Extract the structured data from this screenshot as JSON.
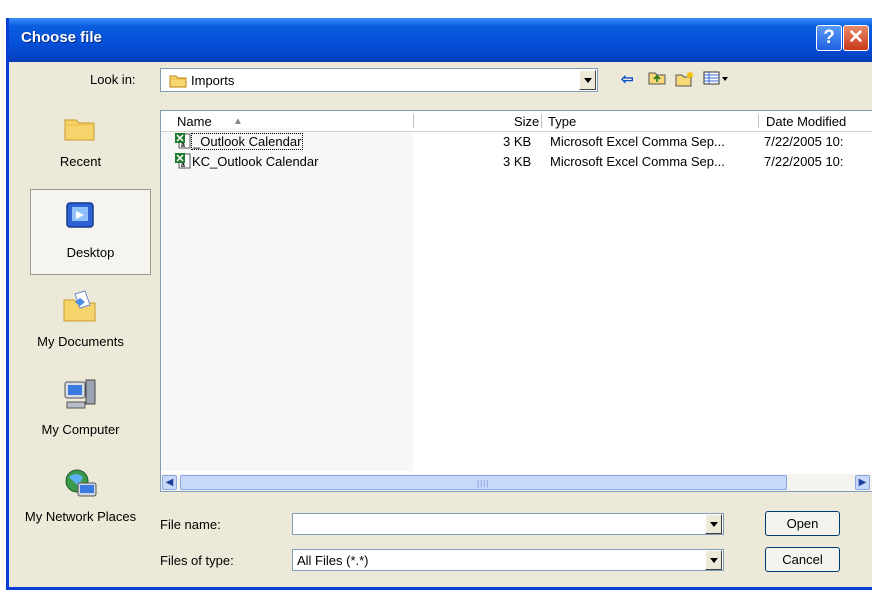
{
  "window": {
    "title": "Choose file"
  },
  "titlebar": {
    "help": "?",
    "close": "✕"
  },
  "lookin": {
    "label": "Look in:",
    "value": "Imports"
  },
  "toolbar": {
    "back": "⇦",
    "up": "⮤",
    "new_folder": "✱",
    "views": "▦▾"
  },
  "places": [
    {
      "label": "Recent",
      "icon": "recent-folder-icon"
    },
    {
      "label": "Desktop",
      "icon": "desktop-icon"
    },
    {
      "label": "My Documents",
      "icon": "my-documents-icon"
    },
    {
      "label": "My Computer",
      "icon": "my-computer-icon"
    },
    {
      "label": "My Network Places",
      "icon": "network-places-icon"
    }
  ],
  "columns": {
    "name": "Name",
    "size": "Size",
    "type": "Type",
    "date": "Date Modified"
  },
  "files": [
    {
      "name": "_Outlook Calendar",
      "size": "3 KB",
      "type": "Microsoft Excel Comma Sep...",
      "date": "7/22/2005 10:"
    },
    {
      "name": "KC_Outlook Calendar",
      "size": "3 KB",
      "type": "Microsoft Excel Comma Sep...",
      "date": "7/22/2005 10:"
    }
  ],
  "filename": {
    "label": "File name:",
    "value": ""
  },
  "filetype": {
    "label": "Files of type:",
    "value": "All Files (*.*)"
  },
  "buttons": {
    "open": "Open",
    "cancel": "Cancel"
  },
  "colors": {
    "titlebar": "#0550D8",
    "dialog_bg": "#ECE9D8",
    "excel_green": "#1F7A2E"
  }
}
